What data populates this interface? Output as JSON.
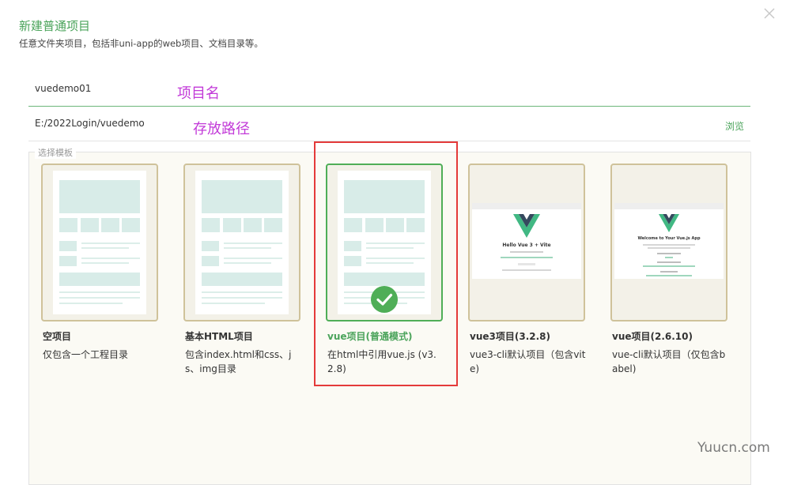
{
  "dialog": {
    "title": "新建普通项目",
    "subtitle": "任意文件夹项目，包括非uni-app的web项目、文档目录等。"
  },
  "project_name": {
    "value": "vuedemo01",
    "annotation": "项目名"
  },
  "project_path": {
    "value": "E:/2022Login/vuedemo",
    "annotation": "存放路径",
    "browse_label": "浏览"
  },
  "templates": {
    "legend": "选择模板",
    "items": [
      {
        "title": "空项目",
        "desc": "仅包含一个工程目录",
        "selected": false,
        "preview": "layout"
      },
      {
        "title": "基本HTML项目",
        "desc": "包含index.html和css、js、img目录",
        "selected": false,
        "preview": "layout"
      },
      {
        "title": "vue项目(普通模式)",
        "desc": "在html中引用vue.js (v3.2.8)",
        "selected": true,
        "preview": "layout"
      },
      {
        "title": "vue3项目(3.2.8)",
        "desc": "vue3-cli默认项目（包含vite)",
        "selected": false,
        "preview": "vue-logo"
      },
      {
        "title": "vue项目(2.6.10)",
        "desc": "vue-cli默认项目（仅包含babel)",
        "selected": false,
        "preview": "vue-logo"
      }
    ]
  },
  "vue3_preview": {
    "heading": "Hello Vue 3 + Vite"
  },
  "vue2_preview": {
    "heading": "Welcome to Your Vue.js App"
  },
  "colors": {
    "accent": "#4aa35a",
    "selected_border": "#4fae57",
    "card_border": "#cfc29a",
    "highlight": "#e43a3a",
    "annotation": "#c23ad8"
  },
  "watermark": "Yuucn.com"
}
